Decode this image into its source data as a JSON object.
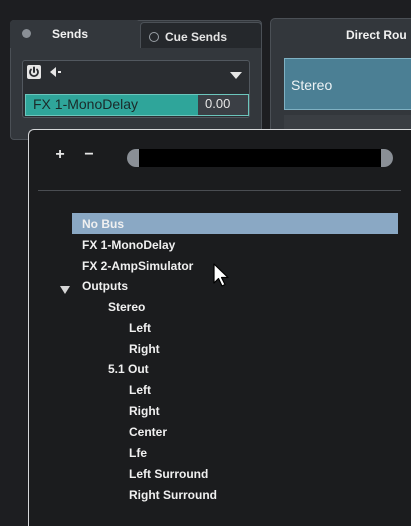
{
  "sends_panel": {
    "tab_sends": "Sends",
    "tab_cue": "Cue Sends",
    "send_name": "FX 1-MonoDelay",
    "send_level": "0.00"
  },
  "direct_routing": {
    "title": "Direct Rou",
    "value": "Stereo"
  },
  "popup": {
    "plus": "+",
    "minus": "−",
    "items": [
      "No Bus",
      "FX 1-MonoDelay",
      "FX 2-AmpSimulator",
      "Outputs",
      "Stereo",
      "Left",
      "Right",
      "5.1 Out",
      "Left",
      "Right",
      "Center",
      "Lfe",
      "Left Surround",
      "Right Surround"
    ]
  },
  "colors": {
    "accent_teal": "#2fa59a",
    "highlight": "#8aa8c4",
    "direct_blue": "#4b7f94"
  },
  "icons": [
    "power-icon",
    "prepost-icon",
    "dropdown-arrow-icon",
    "tree-expand-arrow-icon",
    "mouse-cursor-icon"
  ]
}
